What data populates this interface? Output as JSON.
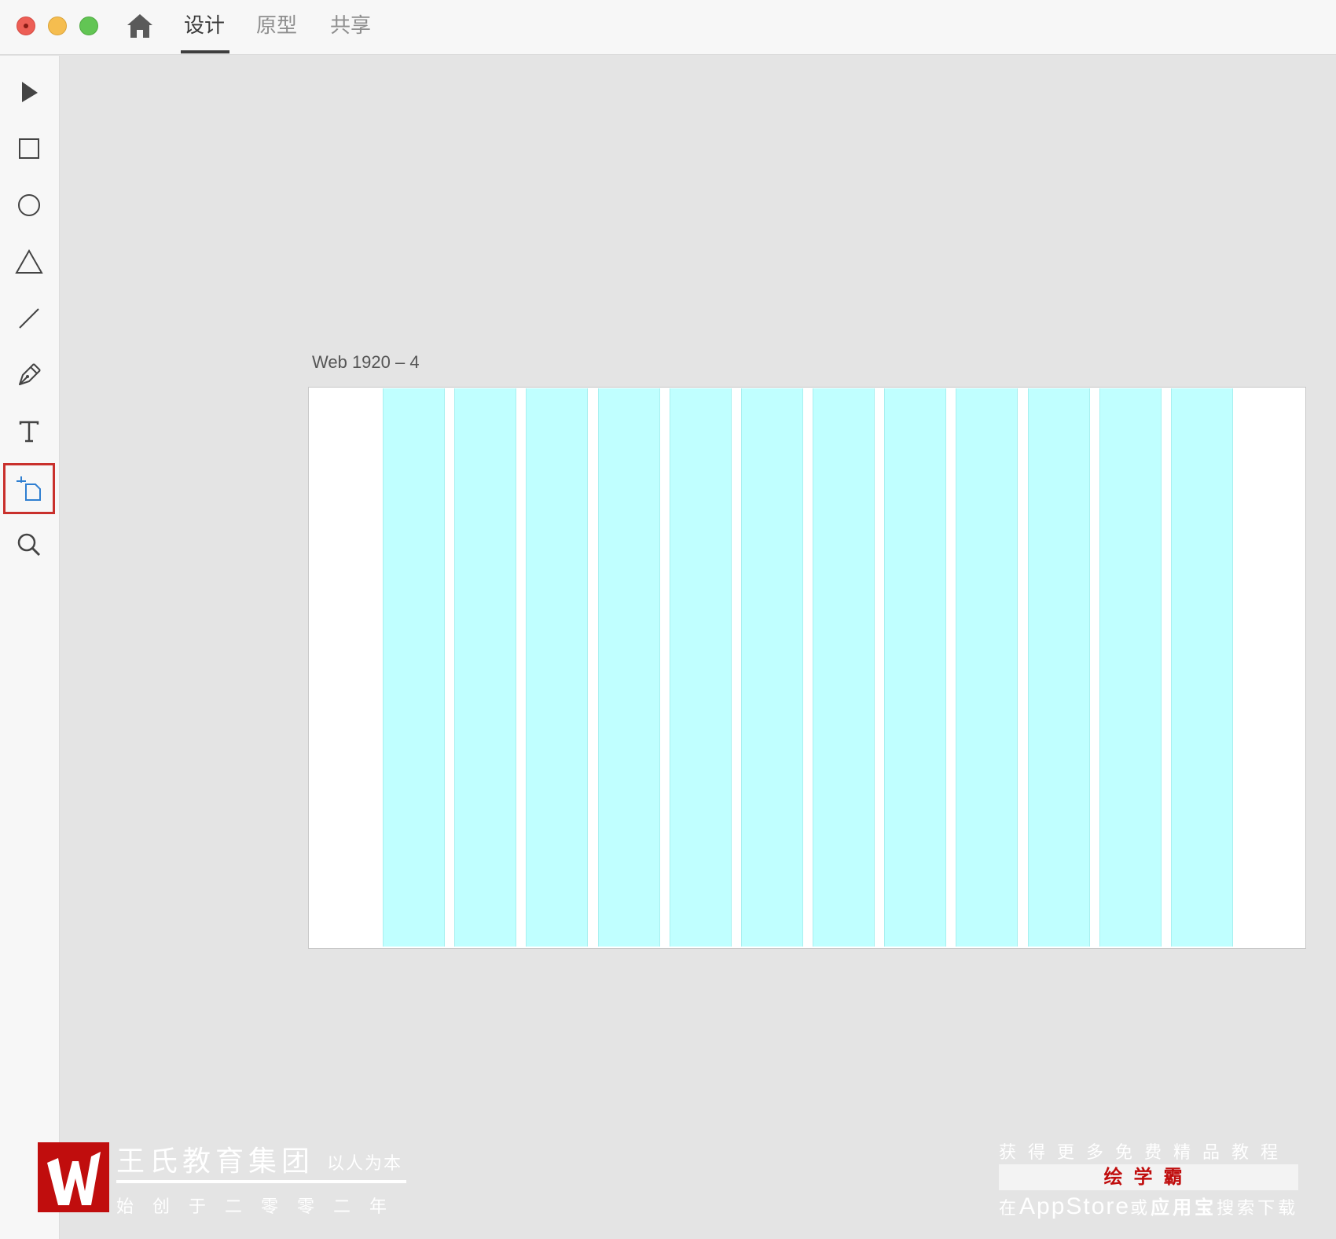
{
  "window": {
    "tabs": [
      {
        "label": "设计",
        "active": true
      },
      {
        "label": "原型",
        "active": false
      },
      {
        "label": "共享",
        "active": false
      }
    ]
  },
  "toolbar": {
    "tools": [
      {
        "name": "select-tool",
        "icon": "arrow-pointer-icon"
      },
      {
        "name": "rectangle-tool",
        "icon": "rectangle-icon"
      },
      {
        "name": "ellipse-tool",
        "icon": "ellipse-icon"
      },
      {
        "name": "polygon-tool",
        "icon": "triangle-icon"
      },
      {
        "name": "line-tool",
        "icon": "line-icon"
      },
      {
        "name": "pen-tool",
        "icon": "pen-icon"
      },
      {
        "name": "text-tool",
        "icon": "text-icon"
      },
      {
        "name": "artboard-tool",
        "icon": "artboard-icon",
        "selected": true
      },
      {
        "name": "zoom-tool",
        "icon": "search-icon"
      }
    ]
  },
  "artboard": {
    "label": "Web 1920 – 4",
    "grid_columns": 12
  },
  "watermark_left": {
    "name": "王氏教育集团",
    "motto": "以人为本",
    "sub": "始创于二零零二年"
  },
  "watermark_right": {
    "top": "获得更多免费精品教程",
    "brand": "绘学霸",
    "bottom_pre": "在",
    "bottom_store": "AppStore",
    "bottom_or": "或",
    "bottom_app": "应用宝",
    "bottom_post": "搜索下载"
  },
  "colors": {
    "grid_fill": "#c0ffff",
    "selection_outline": "#c9302c",
    "brand_red": "#c00d0d"
  }
}
